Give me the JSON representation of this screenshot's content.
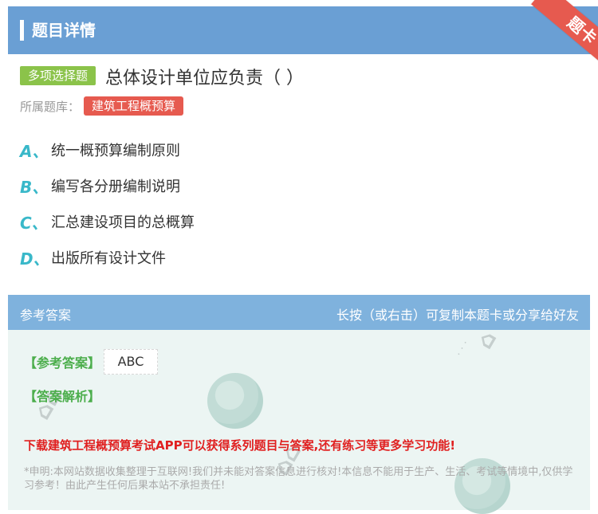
{
  "header": {
    "title": "题目详情",
    "corner_tag": "题卡"
  },
  "question": {
    "type": "多项选择题",
    "text": "总体设计单位应负责（ ）",
    "bank_label": "所属题库：",
    "bank_name": "建筑工程概预算"
  },
  "options": [
    {
      "letter": "A、",
      "text": "统一概预算编制原则"
    },
    {
      "letter": "B、",
      "text": "编写各分册编制说明"
    },
    {
      "letter": "C、",
      "text": "汇总建设项目的总概算"
    },
    {
      "letter": "D、",
      "text": "出版所有设计文件"
    }
  ],
  "answer": {
    "section_title": "参考答案",
    "share_hint": "长按（或右击）可复制本题卡或分享给好友",
    "answer_label": "【参考答案】",
    "answer_value": "ABC",
    "explain_label": "【答案解析】",
    "promo": "下载建筑工程概预算考试APP可以获得系列题目与答案,还有练习等更多学习功能!",
    "disclaimer": "*申明:本网站数据收集整理于互联网!我们并未能对答案信息进行核对!本信息不能用于生产、生活、考试等情境中,仅供学习参考！由此产生任何后果本站不承担责任!"
  },
  "colors": {
    "header_bg": "#6a9fd4",
    "accent_teal": "#39b8c9",
    "type_badge": "#8bc34a",
    "bank_badge": "#e65a4f",
    "answer_green": "#4cae4c",
    "promo_red": "#e02020"
  }
}
